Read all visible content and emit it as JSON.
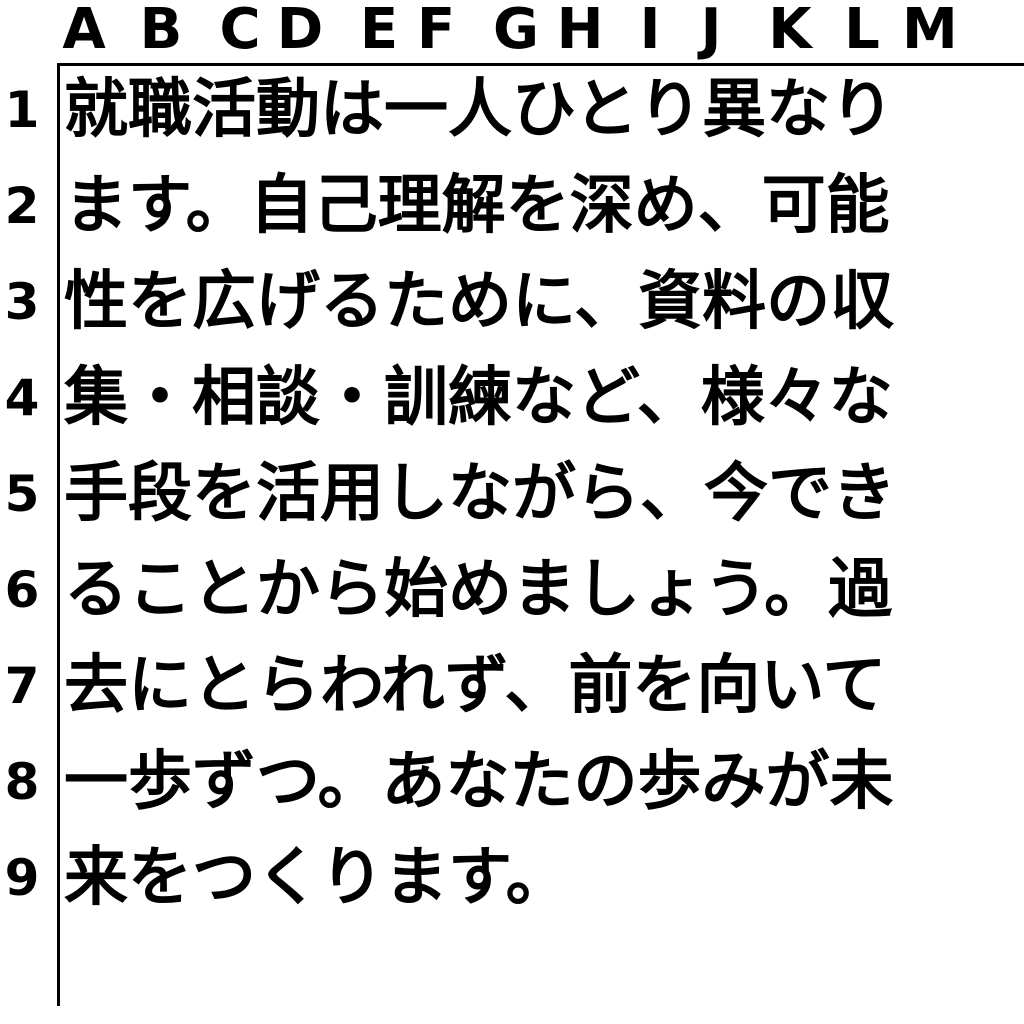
{
  "columns": [
    "A",
    "B",
    "C",
    "D",
    "E",
    "F",
    "G",
    "H",
    "I",
    "J",
    "K",
    "L",
    "M"
  ],
  "rows": [
    {
      "number": "1",
      "text": "就職活動は一人ひとり異なり"
    },
    {
      "number": "2",
      "text": "ます。自己理解を深め、可能"
    },
    {
      "number": "3",
      "text": "性を広げるために、資料の収"
    },
    {
      "number": "4",
      "text": "集・相談・訓練など、様々な"
    },
    {
      "number": "5",
      "text": "手段を活用しながら、今でき"
    },
    {
      "number": "6",
      "text": "ることから始めましょう。過"
    },
    {
      "number": "7",
      "text": "去にとらわれず、前を向いて"
    },
    {
      "number": "8",
      "text": "一歩ずつ。あなたの歩みが未"
    },
    {
      "number": "9",
      "text": "来をつくります。"
    }
  ]
}
